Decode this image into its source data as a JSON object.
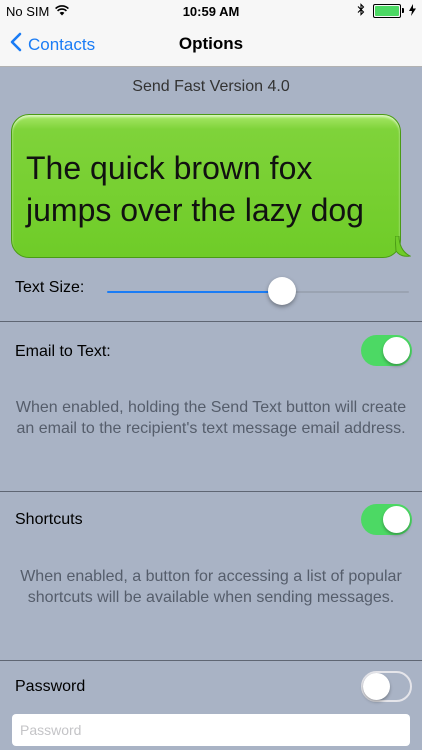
{
  "status_bar": {
    "carrier": "No SIM",
    "time": "10:59 AM",
    "battery_level": 1.0,
    "battery_color": "#4cd964"
  },
  "nav": {
    "back_label": "Contacts",
    "title": "Options",
    "accent": "#1a7cf5"
  },
  "version_text": "Send Fast Version 4.0",
  "preview": {
    "text": "The quick brown fox jumps over the lazy dog",
    "bubble_color": "#6fcc28"
  },
  "text_size": {
    "label": "Text Size:",
    "value": 0.58
  },
  "email_to_text": {
    "label": "Email to Text:",
    "enabled": true,
    "description": "When enabled, holding the Send Text button will create an email to the recipient's text message email address."
  },
  "shortcuts": {
    "label": "Shortcuts",
    "enabled": true,
    "description": "When enabled, a button for accessing a list of popular shortcuts will be available when sending messages."
  },
  "password": {
    "label": "Password",
    "enabled": false,
    "placeholder": "Password",
    "value": ""
  }
}
